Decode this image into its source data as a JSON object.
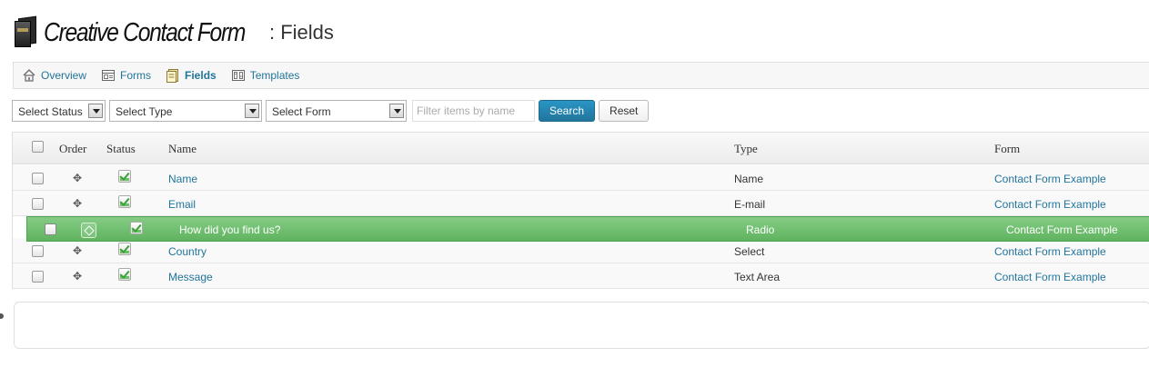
{
  "header": {
    "app_title": "Creative Contact Form",
    "page_subtitle": ": Fields"
  },
  "nav": [
    {
      "label": "Overview",
      "icon": "home-icon"
    },
    {
      "label": "Forms",
      "icon": "forms-icon"
    },
    {
      "label": "Fields",
      "icon": "fields-icon",
      "active": true
    },
    {
      "label": "Templates",
      "icon": "templates-icon"
    }
  ],
  "filters": {
    "status_select": "Select Status",
    "type_select": "Select Type",
    "form_select": "Select Form",
    "search_placeholder": "Filter items by name",
    "search_button": "Search",
    "reset_button": "Reset"
  },
  "table": {
    "columns": [
      "Order",
      "Status",
      "Name",
      "Type",
      "Form"
    ],
    "rows": [
      {
        "name": "Name",
        "type": "Name",
        "form": "Contact Form Example"
      },
      {
        "name": "Email",
        "type": "E-mail",
        "form": "Contact Form Example"
      },
      {
        "name": "Country",
        "type": "Select",
        "form": "Contact Form Example"
      },
      {
        "name": "Message",
        "type": "Text Area",
        "form": "Contact Form Example"
      }
    ],
    "dragging_row": {
      "name": "How did you find us?",
      "type": "Radio",
      "form": "Contact Form Example"
    }
  },
  "colors": {
    "link": "#21759b",
    "drag_highlight": "#6ebd6e",
    "primary_button": "#21759b"
  }
}
